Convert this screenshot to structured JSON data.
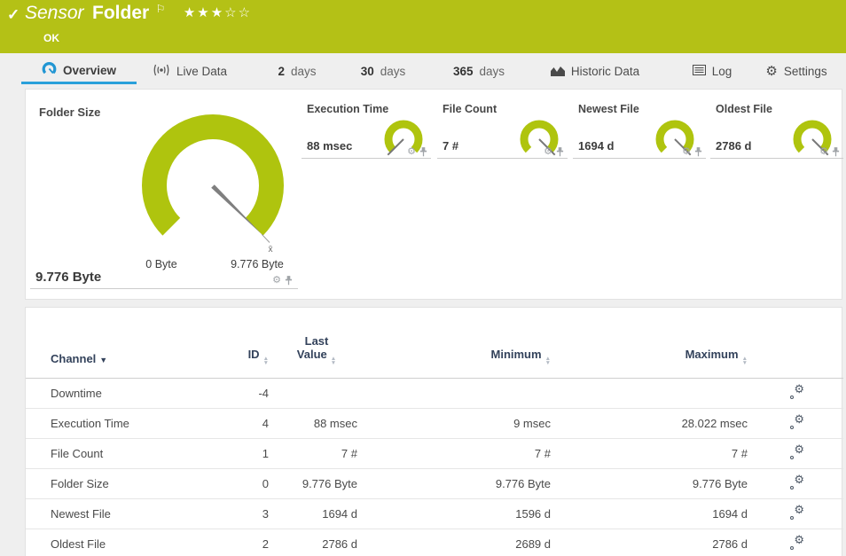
{
  "header": {
    "prefix": "Sensor",
    "name": "Folder",
    "status": "OK",
    "stars": "★★★☆☆"
  },
  "tabs": [
    {
      "label": "Overview",
      "icon": "gauge-icon",
      "active": true
    },
    {
      "label": "Live Data",
      "icon": "live-data-icon"
    },
    {
      "num": "2",
      "unit": "days"
    },
    {
      "num": "30",
      "unit": "days"
    },
    {
      "num": "365",
      "unit": "days"
    },
    {
      "label": "Historic Data",
      "icon": "historic-data-icon"
    },
    {
      "label": "Log",
      "icon": "log-icon"
    },
    {
      "label": "Settings",
      "icon": "gear-icon"
    }
  ],
  "gauges": {
    "main": {
      "title": "Folder Size",
      "value": "9.776 Byte",
      "scale_min": "0 Byte",
      "scale_max": "9.776 Byte",
      "avg_marker": "x̄"
    },
    "minis": [
      {
        "title": "Execution Time",
        "value": "88 msec"
      },
      {
        "title": "File Count",
        "value": "7 #"
      },
      {
        "title": "Newest File",
        "value": "1694 d"
      },
      {
        "title": "Oldest File",
        "value": "2786 d"
      }
    ]
  },
  "table": {
    "headers": {
      "channel": "Channel",
      "id": "ID",
      "last1": "Last",
      "last2": "Value",
      "minimum": "Minimum",
      "maximum": "Maximum"
    },
    "rows": [
      {
        "channel": "Downtime",
        "id": "-4",
        "last": "",
        "min": "",
        "max": ""
      },
      {
        "channel": "Execution Time",
        "id": "4",
        "last": "88 msec",
        "min": "9 msec",
        "max": "28.022 msec"
      },
      {
        "channel": "File Count",
        "id": "1",
        "last": "7 #",
        "min": "7 #",
        "max": "7 #"
      },
      {
        "channel": "Folder Size",
        "id": "0",
        "last": "9.776 Byte",
        "min": "9.776 Byte",
        "max": "9.776 Byte"
      },
      {
        "channel": "Newest File",
        "id": "3",
        "last": "1694 d",
        "min": "1596 d",
        "max": "1694 d"
      },
      {
        "channel": "Oldest File",
        "id": "2",
        "last": "2786 d",
        "min": "2689 d",
        "max": "2786 d"
      }
    ]
  },
  "colors": {
    "header_green": "#b4c116",
    "gauge_green": "#afc40e",
    "accent_blue": "#2aa0da",
    "table_header_text": "#33425b",
    "needle_gray": "#7f7f7f"
  }
}
